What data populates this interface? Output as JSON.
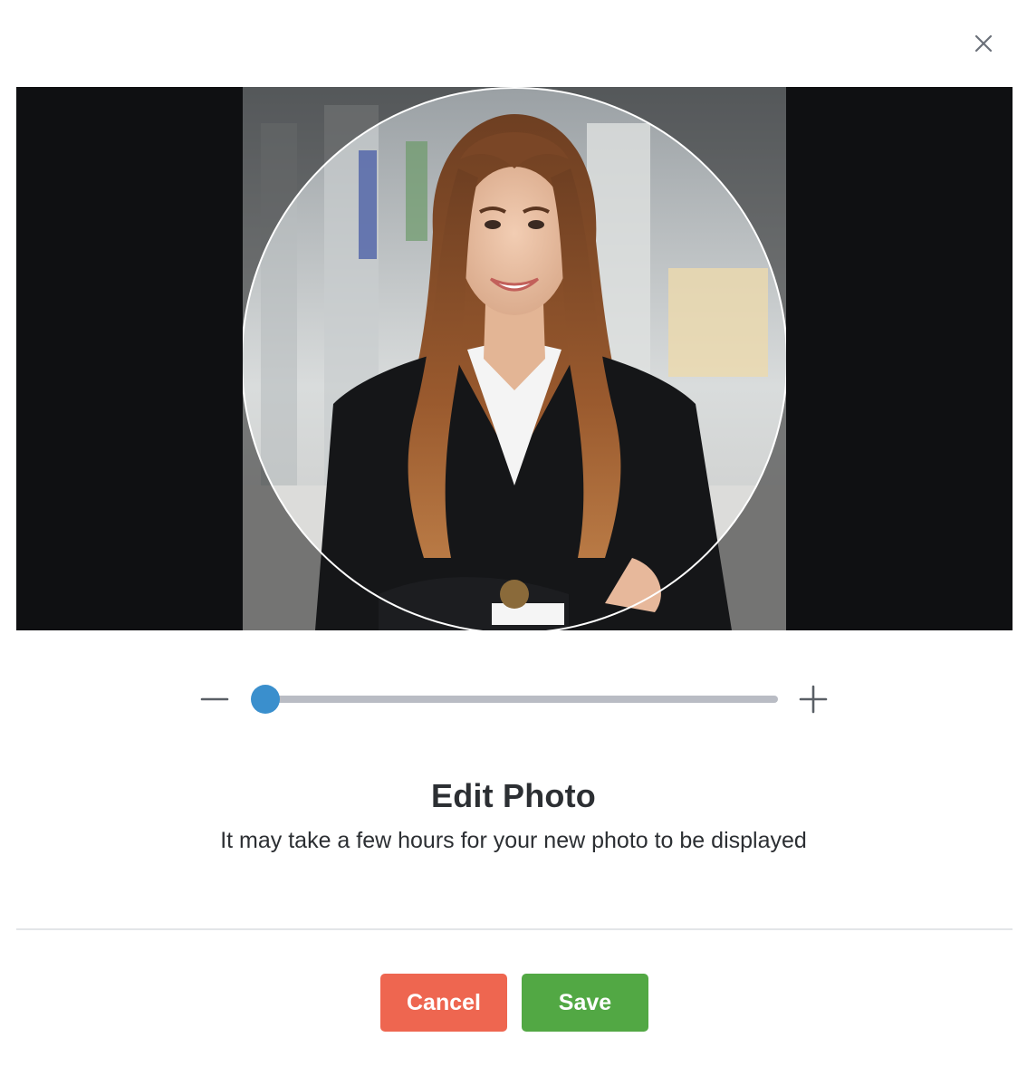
{
  "dialog": {
    "title": "Edit Photo",
    "subtitle": "It may take a few hours for your new photo to be displayed",
    "close_icon": "close-icon"
  },
  "zoom": {
    "minus_icon": "minus-icon",
    "plus_icon": "plus-icon",
    "level": 0.0
  },
  "buttons": {
    "cancel_label": "Cancel",
    "save_label": "Save"
  },
  "colors": {
    "cancel": "#ee6650",
    "save": "#52a844",
    "slider_thumb": "#3a8fcd",
    "cropper_background": "#0f1012"
  }
}
